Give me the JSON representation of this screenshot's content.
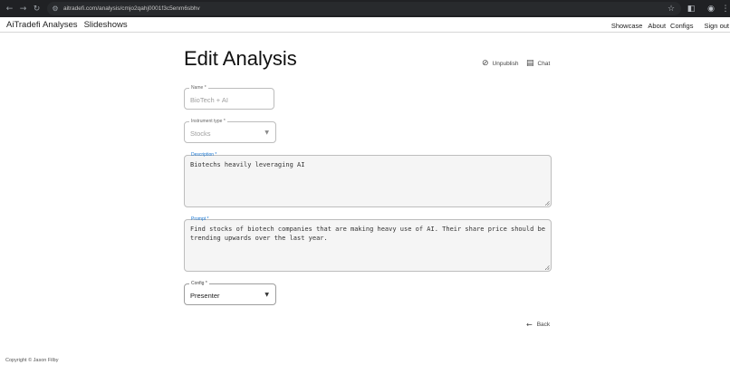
{
  "browser": {
    "url": "aitradefi.com/analysis/cmjo2qahj0001f3c5enm6sbhv",
    "icons": [
      "back-arrow-icon",
      "forward-arrow-icon",
      "reload-icon",
      "site-info-icon",
      "bookmark-star-icon",
      "extensions-icon",
      "profile-icon",
      "menu-kebab-icon"
    ]
  },
  "navbar": {
    "brand": "AiTradefi",
    "left_links": [
      "Analyses",
      "Slideshows"
    ],
    "right_links": [
      "Showcase",
      "About",
      "Configs",
      "Sign out"
    ]
  },
  "page": {
    "title": "Edit Analysis",
    "unpublish_label": "Unpublish",
    "chat_label": "Chat"
  },
  "form": {
    "name": {
      "label": "Name *",
      "value": "BioTech + AI"
    },
    "instrument_type": {
      "label": "Instrument type *",
      "value": "Stocks"
    },
    "description": {
      "label": "Description *",
      "value": "Biotechs heavily leveraging AI"
    },
    "prompt": {
      "label": "Prompt *",
      "line1": "Find stocks of biotech companies that are making heavy use of AI. Their share price should be",
      "line2": "trending upwards over the last year."
    },
    "config": {
      "label": "Config *",
      "value": "Presenter"
    }
  },
  "back_label": "Back",
  "footer": "Copyright © Jason Filby",
  "colors": {
    "chrome_bg": "#202124",
    "focus_label": "#1976d2",
    "field_border": "#bdbdbd"
  }
}
